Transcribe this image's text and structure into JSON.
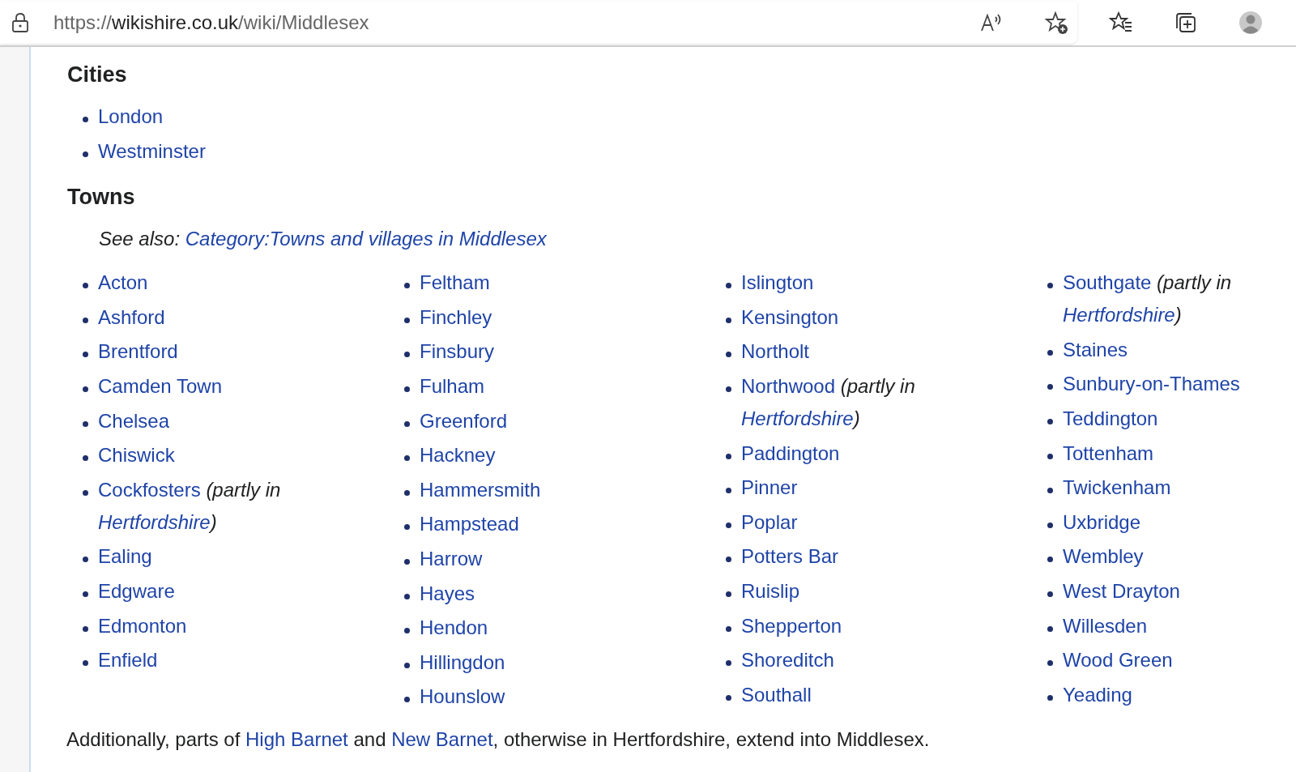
{
  "browser": {
    "url": {
      "scheme": "https://",
      "host": "wikishire.co.uk",
      "path": "/wiki/Middlesex"
    }
  },
  "sections": [
    {
      "heading": "Cities",
      "columns": [
        [
          {
            "name": "London"
          },
          {
            "name": "Westminster"
          }
        ]
      ]
    },
    {
      "heading": "Towns",
      "see_also": {
        "label": "See also:",
        "link": "Category:Towns and villages in Middlesex"
      },
      "columns": [
        [
          {
            "name": "Acton"
          },
          {
            "name": "Ashford"
          },
          {
            "name": "Brentford"
          },
          {
            "name": "Camden Town"
          },
          {
            "name": "Chelsea"
          },
          {
            "name": "Chiswick"
          },
          {
            "name": "Cockfosters",
            "note_before": "(partly in",
            "note_link": "Hertfordshire",
            "note_after": ")"
          },
          {
            "name": "Ealing"
          },
          {
            "name": "Edgware"
          },
          {
            "name": "Edmonton"
          },
          {
            "name": "Enfield"
          }
        ],
        [
          {
            "name": "Feltham"
          },
          {
            "name": "Finchley"
          },
          {
            "name": "Finsbury"
          },
          {
            "name": "Fulham"
          },
          {
            "name": "Greenford"
          },
          {
            "name": "Hackney"
          },
          {
            "name": "Hammersmith"
          },
          {
            "name": "Hampstead"
          },
          {
            "name": "Harrow"
          },
          {
            "name": "Hayes"
          },
          {
            "name": "Hendon"
          },
          {
            "name": "Hillingdon"
          },
          {
            "name": "Hounslow"
          }
        ],
        [
          {
            "name": "Islington"
          },
          {
            "name": "Kensington"
          },
          {
            "name": "Northolt"
          },
          {
            "name": "Northwood",
            "note_before": "(partly in",
            "note_link": "Hertfordshire",
            "note_after": ")"
          },
          {
            "name": "Paddington"
          },
          {
            "name": "Pinner"
          },
          {
            "name": "Poplar"
          },
          {
            "name": "Potters Bar"
          },
          {
            "name": "Ruislip"
          },
          {
            "name": "Shepperton"
          },
          {
            "name": "Shoreditch"
          },
          {
            "name": "Southall"
          }
        ],
        [
          {
            "name": "Southgate",
            "note_before": "(partly in",
            "note_link": "Hertfordshire",
            "note_after": ")"
          },
          {
            "name": "Staines"
          },
          {
            "name": "Sunbury-on-Thames"
          },
          {
            "name": "Teddington"
          },
          {
            "name": "Tottenham"
          },
          {
            "name": "Twickenham"
          },
          {
            "name": "Uxbridge"
          },
          {
            "name": "Wembley"
          },
          {
            "name": "West Drayton"
          },
          {
            "name": "Willesden"
          },
          {
            "name": "Wood Green"
          },
          {
            "name": "Yeading"
          }
        ]
      ]
    }
  ],
  "paragraph": [
    {
      "kind": "text",
      "text": "Additionally, parts of "
    },
    {
      "kind": "link",
      "text": "High Barnet"
    },
    {
      "kind": "text",
      "text": " and "
    },
    {
      "kind": "link",
      "text": "New Barnet"
    },
    {
      "kind": "text",
      "text": ", otherwise in Hertfordshire, extend into Middlesex."
    }
  ]
}
